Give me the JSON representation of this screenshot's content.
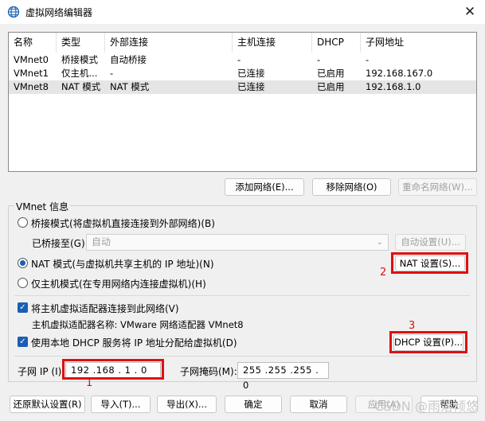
{
  "window": {
    "title": "虚拟网络编辑器",
    "close": "✕"
  },
  "network_table": {
    "headers": [
      "名称",
      "类型",
      "外部连接",
      "主机连接",
      "DHCP",
      "子网地址"
    ],
    "rows": [
      [
        "VMnet0",
        "桥接模式",
        "自动桥接",
        "-",
        "-",
        "-"
      ],
      [
        "VMnet1",
        "仅主机...",
        "-",
        "已连接",
        "已启用",
        "192.168.167.0"
      ],
      [
        "VMnet8",
        "NAT 模式",
        "NAT 模式",
        "已连接",
        "已启用",
        "192.168.1.0"
      ]
    ],
    "selected_row": 2
  },
  "network_buttons": {
    "add": "添加网络(E)...",
    "remove": "移除网络(O)",
    "rename": "重命名网络(W)..."
  },
  "vmnet_info": {
    "group_label": "VMnet 信息",
    "bridged_mode": "桥接模式(将虚拟机直接连接到外部网络)(B)",
    "bridged_to_label": "已桥接至(G):",
    "bridged_to_value": "自动",
    "auto_settings": "自动设置(U)...",
    "nat_mode": "NAT 模式(与虚拟机共享主机的 IP 地址)(N)",
    "nat_settings": "NAT 设置(S)...",
    "host_only": "仅主机模式(在专用网络内连接虚拟机)(H)",
    "connect_adapter": "将主机虚拟适配器连接到此网络(V)",
    "adapter_name": "主机虚拟适配器名称: VMware 网络适配器 VMnet8",
    "use_dhcp": "使用本地 DHCP 服务将 IP 地址分配给虚拟机(D)",
    "dhcp_settings": "DHCP 设置(P)...",
    "subnet_ip_label": "子网 IP (I):",
    "subnet_ip": "192 .168 .  1  .  0",
    "subnet_mask_label": "子网掩码(M):",
    "subnet_mask": "255 .255 .255 .  0",
    "selected_mode": "nat"
  },
  "footer_buttons": {
    "restore": "还原默认设置(R)",
    "import": "导入(T)...",
    "export": "导出(X)...",
    "ok": "确定",
    "cancel": "取消",
    "apply": "应用(A)",
    "help": "帮助"
  },
  "annotations": {
    "label1": "1",
    "label2": "2",
    "label3": "3",
    "color": "#e01010"
  },
  "watermark": "CSDN @雨落倾悠"
}
